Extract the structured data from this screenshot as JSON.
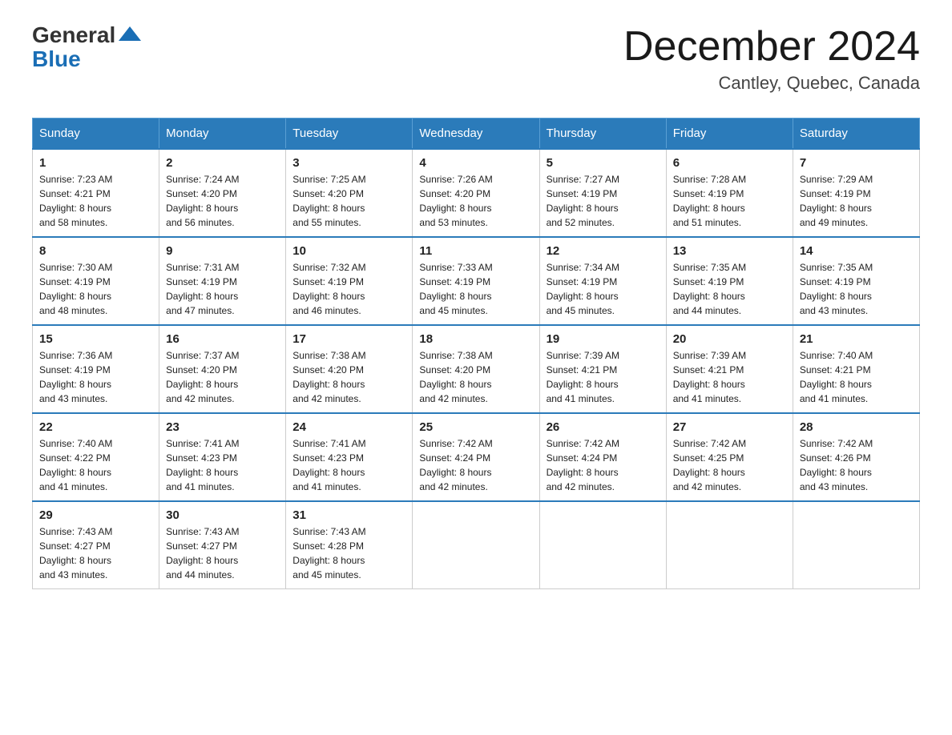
{
  "header": {
    "logo_general": "General",
    "logo_blue": "Blue",
    "month_title": "December 2024",
    "location": "Cantley, Quebec, Canada"
  },
  "days_of_week": [
    "Sunday",
    "Monday",
    "Tuesday",
    "Wednesday",
    "Thursday",
    "Friday",
    "Saturday"
  ],
  "weeks": [
    [
      {
        "day": "1",
        "sunrise": "7:23 AM",
        "sunset": "4:21 PM",
        "daylight": "8 hours and 58 minutes."
      },
      {
        "day": "2",
        "sunrise": "7:24 AM",
        "sunset": "4:20 PM",
        "daylight": "8 hours and 56 minutes."
      },
      {
        "day": "3",
        "sunrise": "7:25 AM",
        "sunset": "4:20 PM",
        "daylight": "8 hours and 55 minutes."
      },
      {
        "day": "4",
        "sunrise": "7:26 AM",
        "sunset": "4:20 PM",
        "daylight": "8 hours and 53 minutes."
      },
      {
        "day": "5",
        "sunrise": "7:27 AM",
        "sunset": "4:19 PM",
        "daylight": "8 hours and 52 minutes."
      },
      {
        "day": "6",
        "sunrise": "7:28 AM",
        "sunset": "4:19 PM",
        "daylight": "8 hours and 51 minutes."
      },
      {
        "day": "7",
        "sunrise": "7:29 AM",
        "sunset": "4:19 PM",
        "daylight": "8 hours and 49 minutes."
      }
    ],
    [
      {
        "day": "8",
        "sunrise": "7:30 AM",
        "sunset": "4:19 PM",
        "daylight": "8 hours and 48 minutes."
      },
      {
        "day": "9",
        "sunrise": "7:31 AM",
        "sunset": "4:19 PM",
        "daylight": "8 hours and 47 minutes."
      },
      {
        "day": "10",
        "sunrise": "7:32 AM",
        "sunset": "4:19 PM",
        "daylight": "8 hours and 46 minutes."
      },
      {
        "day": "11",
        "sunrise": "7:33 AM",
        "sunset": "4:19 PM",
        "daylight": "8 hours and 45 minutes."
      },
      {
        "day": "12",
        "sunrise": "7:34 AM",
        "sunset": "4:19 PM",
        "daylight": "8 hours and 45 minutes."
      },
      {
        "day": "13",
        "sunrise": "7:35 AM",
        "sunset": "4:19 PM",
        "daylight": "8 hours and 44 minutes."
      },
      {
        "day": "14",
        "sunrise": "7:35 AM",
        "sunset": "4:19 PM",
        "daylight": "8 hours and 43 minutes."
      }
    ],
    [
      {
        "day": "15",
        "sunrise": "7:36 AM",
        "sunset": "4:19 PM",
        "daylight": "8 hours and 43 minutes."
      },
      {
        "day": "16",
        "sunrise": "7:37 AM",
        "sunset": "4:20 PM",
        "daylight": "8 hours and 42 minutes."
      },
      {
        "day": "17",
        "sunrise": "7:38 AM",
        "sunset": "4:20 PM",
        "daylight": "8 hours and 42 minutes."
      },
      {
        "day": "18",
        "sunrise": "7:38 AM",
        "sunset": "4:20 PM",
        "daylight": "8 hours and 42 minutes."
      },
      {
        "day": "19",
        "sunrise": "7:39 AM",
        "sunset": "4:21 PM",
        "daylight": "8 hours and 41 minutes."
      },
      {
        "day": "20",
        "sunrise": "7:39 AM",
        "sunset": "4:21 PM",
        "daylight": "8 hours and 41 minutes."
      },
      {
        "day": "21",
        "sunrise": "7:40 AM",
        "sunset": "4:21 PM",
        "daylight": "8 hours and 41 minutes."
      }
    ],
    [
      {
        "day": "22",
        "sunrise": "7:40 AM",
        "sunset": "4:22 PM",
        "daylight": "8 hours and 41 minutes."
      },
      {
        "day": "23",
        "sunrise": "7:41 AM",
        "sunset": "4:23 PM",
        "daylight": "8 hours and 41 minutes."
      },
      {
        "day": "24",
        "sunrise": "7:41 AM",
        "sunset": "4:23 PM",
        "daylight": "8 hours and 41 minutes."
      },
      {
        "day": "25",
        "sunrise": "7:42 AM",
        "sunset": "4:24 PM",
        "daylight": "8 hours and 42 minutes."
      },
      {
        "day": "26",
        "sunrise": "7:42 AM",
        "sunset": "4:24 PM",
        "daylight": "8 hours and 42 minutes."
      },
      {
        "day": "27",
        "sunrise": "7:42 AM",
        "sunset": "4:25 PM",
        "daylight": "8 hours and 42 minutes."
      },
      {
        "day": "28",
        "sunrise": "7:42 AM",
        "sunset": "4:26 PM",
        "daylight": "8 hours and 43 minutes."
      }
    ],
    [
      {
        "day": "29",
        "sunrise": "7:43 AM",
        "sunset": "4:27 PM",
        "daylight": "8 hours and 43 minutes."
      },
      {
        "day": "30",
        "sunrise": "7:43 AM",
        "sunset": "4:27 PM",
        "daylight": "8 hours and 44 minutes."
      },
      {
        "day": "31",
        "sunrise": "7:43 AM",
        "sunset": "4:28 PM",
        "daylight": "8 hours and 45 minutes."
      },
      null,
      null,
      null,
      null
    ]
  ],
  "labels": {
    "sunrise_prefix": "Sunrise: ",
    "sunset_prefix": "Sunset: ",
    "daylight_prefix": "Daylight: "
  }
}
